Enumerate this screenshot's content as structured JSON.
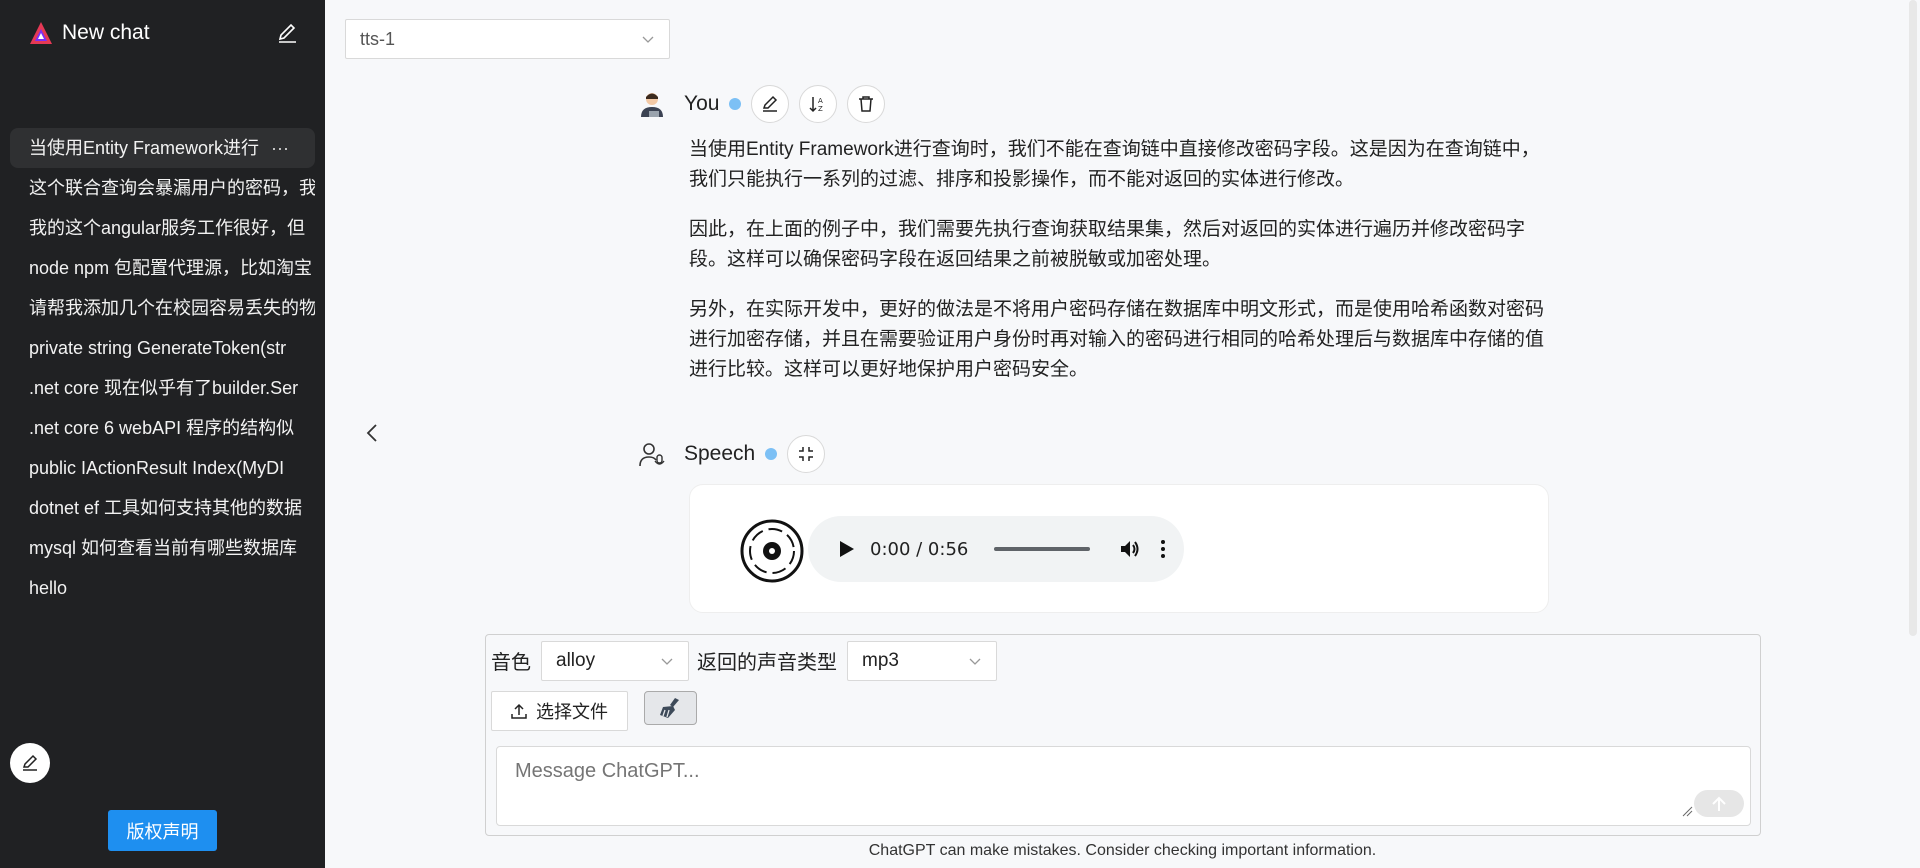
{
  "sidebar": {
    "title": "New chat",
    "history": [
      {
        "label": "当使用Entity Framework进行"
      },
      {
        "label": "这个联合查询会暴漏用户的密码，我"
      },
      {
        "label": "我的这个angular服务工作很好，但"
      },
      {
        "label": "node npm 包配置代理源，比如淘宝"
      },
      {
        "label": "请帮我添加几个在校园容易丢失的物"
      },
      {
        "label": "private string GenerateToken(str"
      },
      {
        "label": ".net core 现在似乎有了builder.Ser"
      },
      {
        "label": ".net core 6 webAPI 程序的结构似"
      },
      {
        "label": "public IActionResult Index(MyDI"
      },
      {
        "label": "dotnet ef 工具如何支持其他的数据"
      },
      {
        "label": "mysql 如何查看当前有哪些数据库"
      },
      {
        "label": "hello"
      }
    ],
    "more_glyph": "···",
    "copyright_label": "版权声明"
  },
  "model": {
    "selected": "tts-1"
  },
  "user_message": {
    "speaker": "You",
    "paragraphs": [
      "当使用Entity Framework进行查询时，我们不能在查询链中直接修改密码字段。这是因为在查询链中，我们只能执行一系列的过滤、排序和投影操作，而不能对返回的实体进行修改。",
      "因此，在上面的例子中，我们需要先执行查询获取结果集，然后对返回的实体进行遍历并修改密码字段。这样可以确保密码字段在返回结果之前被脱敏或加密处理。",
      "另外，在实际开发中，更好的做法是不将用户密码存储在数据库中明文形式，而是使用哈希函数对密码进行加密存储，并且在需要验证用户身份时再对输入的密码进行相同的哈希处理后与数据库中存储的值进行比较。这样可以更好地保护用户密码安全。"
    ]
  },
  "speech_message": {
    "speaker": "Speech",
    "player_time": "0:00 / 0:56"
  },
  "options": {
    "voice_label": "音色",
    "voice_value": "alloy",
    "format_label": "返回的声音类型",
    "format_value": "mp3",
    "file_button": "选择文件"
  },
  "input": {
    "placeholder": "Message ChatGPT..."
  },
  "disclaimer": "ChatGPT can make mistakes. Consider checking important information.",
  "colors": {
    "sidebar_bg": "#202123",
    "accent": "#1e8ff0",
    "status_dot": "#7cc0f5"
  }
}
